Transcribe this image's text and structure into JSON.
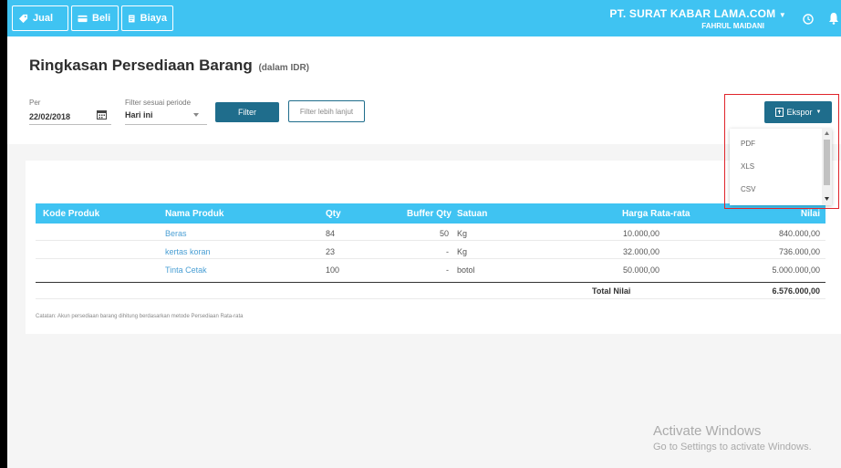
{
  "topbar": {
    "buttons": [
      {
        "label": "Jual",
        "icon": "tag-icon"
      },
      {
        "label": "Beli",
        "icon": "card-icon"
      },
      {
        "label": "Biaya",
        "icon": "receipt-icon"
      }
    ],
    "company_name": "PT. SURAT KABAR LAMA.COM",
    "user_name": "FAHRUL MAIDANI",
    "accent": "#3fc3f2"
  },
  "page": {
    "title": "Ringkasan Persediaan Barang",
    "subtitle": "(dalam IDR)"
  },
  "filters": {
    "per_label": "Per",
    "per_value": "22/02/2018",
    "period_label": "Filter sesuai periode",
    "period_value": "Hari ini",
    "filter_button": "Filter",
    "advanced_button": "Filter lebih lanjut"
  },
  "export": {
    "label": "Ekspor",
    "options": [
      "PDF",
      "XLS",
      "CSV"
    ]
  },
  "table": {
    "headers": {
      "code": "Kode Produk",
      "name": "Nama Produk",
      "qty": "Qty",
      "buffer": "Buffer Qty",
      "unit": "Satuan",
      "avg_price": "Harga Rata-rata",
      "value": "Nilai"
    },
    "rows": [
      {
        "code": "",
        "name": "Beras",
        "qty": "84",
        "buffer": "50",
        "unit": "Kg",
        "avg_price": "10.000,00",
        "value": "840.000,00"
      },
      {
        "code": "",
        "name": "kertas koran",
        "qty": "23",
        "buffer": "-",
        "unit": "Kg",
        "avg_price": "32.000,00",
        "value": "736.000,00"
      },
      {
        "code": "",
        "name": "Tinta Cetak",
        "qty": "100",
        "buffer": "-",
        "unit": "botol",
        "avg_price": "50.000,00",
        "value": "5.000.000,00"
      }
    ],
    "total_label": "Total Nilai",
    "total_value": "6.576.000,00"
  },
  "note": "Catatan: Akun persediaan barang dihitung berdasarkan metode Persediaan Rata-rata",
  "watermark": {
    "line1": "Activate Windows",
    "line2": "Go to Settings to activate Windows."
  }
}
